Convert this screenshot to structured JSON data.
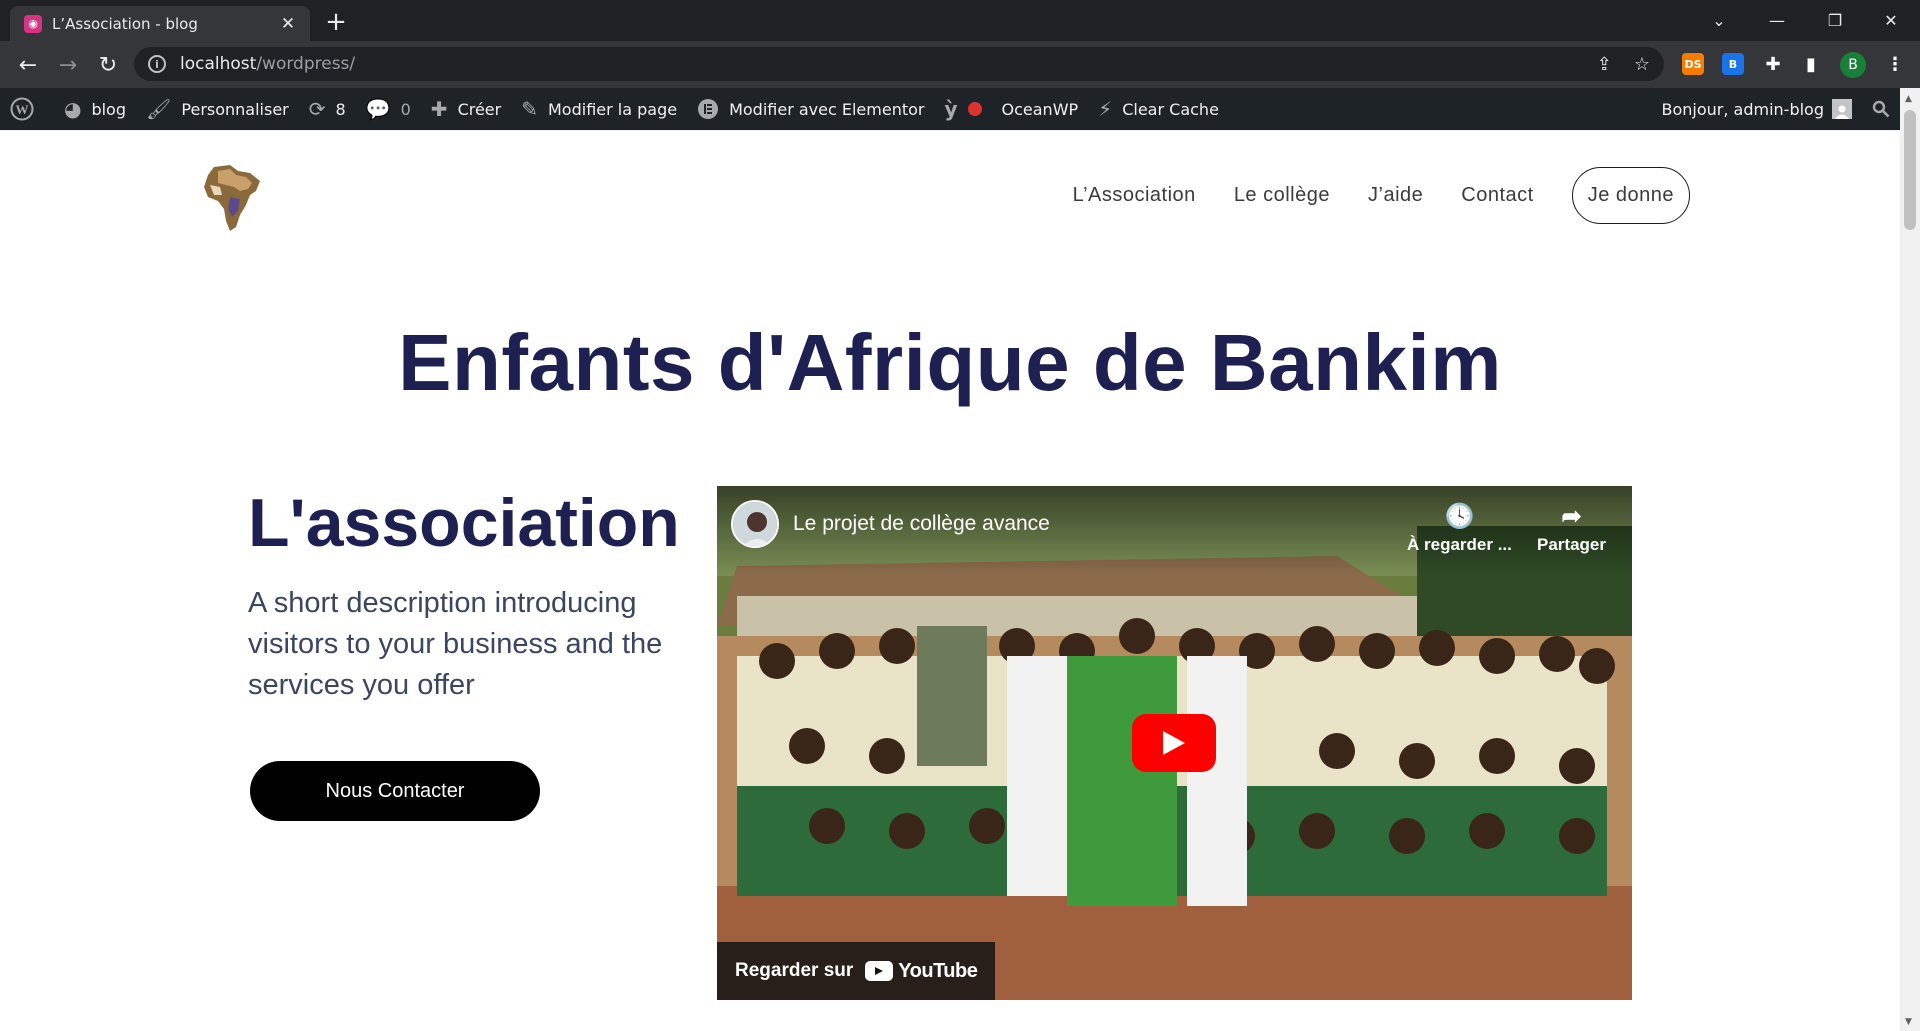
{
  "browser": {
    "tab_title": "L’Association - blog",
    "new_tab_icon": "plus-icon",
    "url_host": "localhost",
    "url_path": "/wordpress/",
    "profile_initial": "B",
    "extensions": [
      {
        "name": "ds-extension",
        "label": "DS",
        "color": "#f57c00"
      },
      {
        "name": "blue-extension",
        "label": "B",
        "color": "#1a73e8"
      }
    ]
  },
  "adminbar": {
    "site_name": "blog",
    "customize": "Personnaliser",
    "updates_count": "8",
    "comments_count": "0",
    "new": "Créer",
    "edit_page": "Modifier la page",
    "edit_elementor": "Modifier avec Elementor",
    "oceanwp": "OceanWP",
    "clear_cache": "Clear Cache",
    "greeting": "Bonjour, admin-blog"
  },
  "site": {
    "nav": [
      "L’Association",
      "Le collège",
      "J’aide",
      "Contact"
    ],
    "nav_cta": "Je donne",
    "hero_title": "Enfants d'Afrique de Bankim",
    "section_title": "L'association",
    "section_desc": "A short description introducing visitors to your business and the services you offer",
    "cta_button": "Nous Contacter"
  },
  "video": {
    "title": "Le projet de collège avance",
    "watch_later": "À regarder ...",
    "share": "Partager",
    "watch_on": "Regarder sur",
    "youtube": "YouTube"
  },
  "colors": {
    "heading": "#1e2052",
    "adminbar": "#1d2327",
    "youtube_red": "#ff0000"
  }
}
